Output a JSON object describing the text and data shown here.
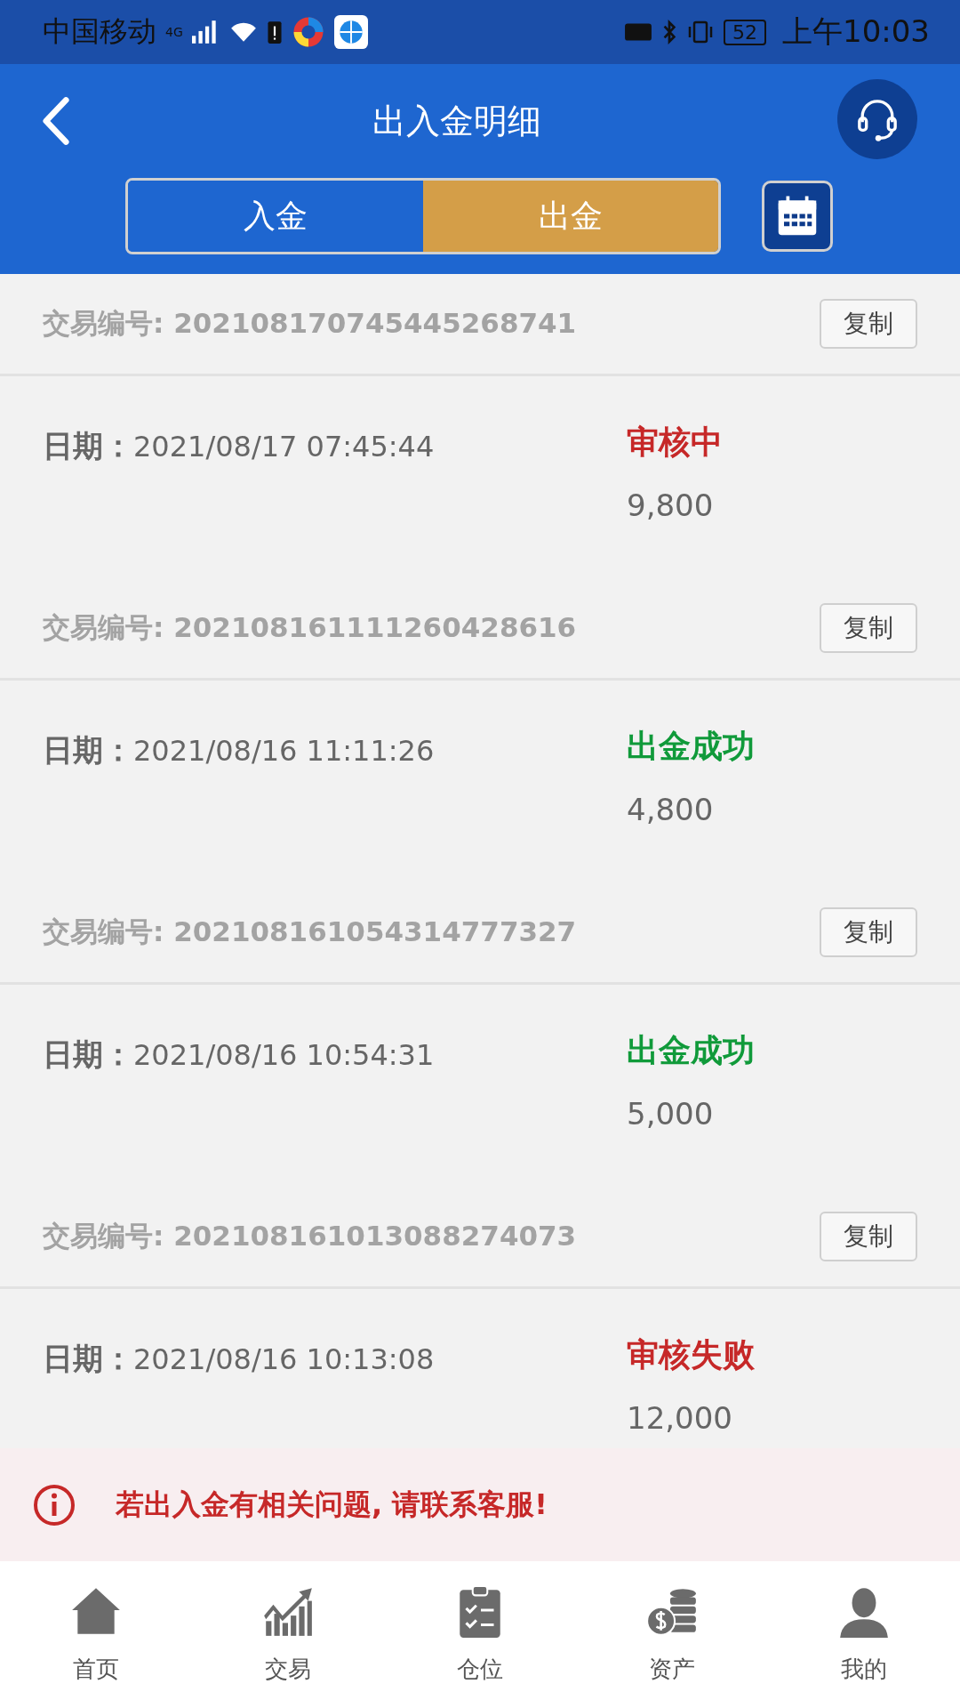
{
  "status_bar": {
    "carrier": "中国移动",
    "network": "4G",
    "battery": "52",
    "time": "上午10:03"
  },
  "header": {
    "title": "出入金明细"
  },
  "tabs": [
    {
      "label": "入金",
      "selected": false
    },
    {
      "label": "出金",
      "selected": true
    }
  ],
  "records": [
    {
      "id_label": "交易编号:",
      "id": "202108170745445268741",
      "copy": "复制",
      "date_label": "日期：",
      "date": "2021/08/17 07:45:44",
      "status": "审核中",
      "kind": "pending",
      "amount": "9,800"
    },
    {
      "id_label": "交易编号:",
      "id": "202108161111260428616",
      "copy": "复制",
      "date_label": "日期：",
      "date": "2021/08/16 11:11:26",
      "status": "出金成功",
      "kind": "success",
      "amount": "4,800"
    },
    {
      "id_label": "交易编号:",
      "id": "202108161054314777327",
      "copy": "复制",
      "date_label": "日期：",
      "date": "2021/08/16 10:54:31",
      "status": "出金成功",
      "kind": "success",
      "amount": "5,000"
    },
    {
      "id_label": "交易编号:",
      "id": "202108161013088274073",
      "copy": "复制",
      "date_label": "日期：",
      "date": "2021/08/16 10:13:08",
      "status": "审核失败",
      "kind": "failed",
      "amount": "12,000"
    }
  ],
  "notice": "若出入金有相关问题, 请联系客服!",
  "nav": [
    {
      "label": "首页",
      "kind": "home"
    },
    {
      "label": "交易",
      "kind": "chart"
    },
    {
      "label": "仓位",
      "kind": "clipboard"
    },
    {
      "label": "资产",
      "kind": "coins"
    },
    {
      "label": "我的",
      "kind": "person"
    }
  ]
}
